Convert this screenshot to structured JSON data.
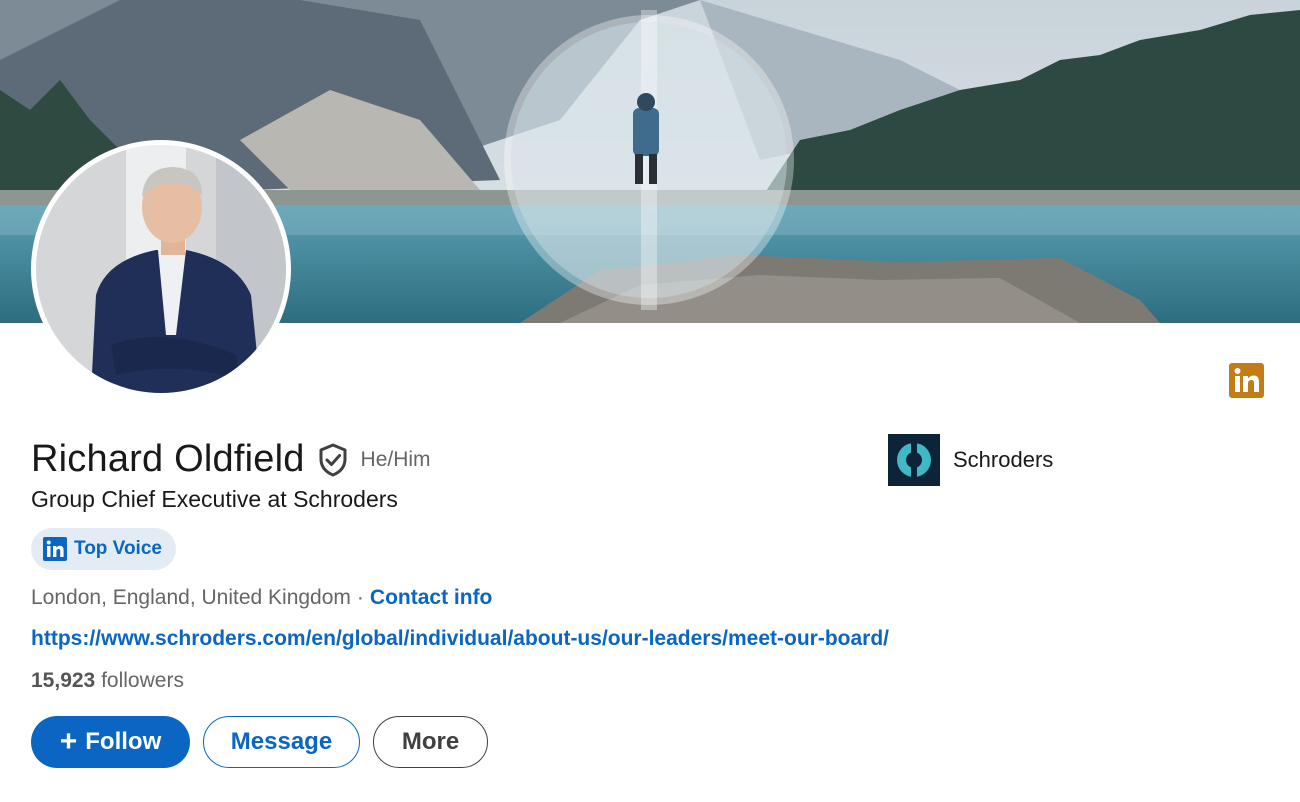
{
  "profile": {
    "name": "Richard Oldfield",
    "pronouns": "He/Him",
    "headline": "Group Chief Executive at Schroders",
    "badge_label": "Top Voice",
    "location": "London, England, United Kingdom",
    "separator": "·",
    "contact_label": "Contact info",
    "website": "https://www.schroders.com/en/global/individual/about-us/our-leaders/meet-our-board/",
    "followers_count": "15,923",
    "followers_label": "followers"
  },
  "company": {
    "name": "Schroders"
  },
  "actions": {
    "follow_icon": "+",
    "follow_label": "Follow",
    "message_label": "Message",
    "more_label": "More"
  },
  "icons": {
    "verified": "shield-check-icon",
    "linkedin": "linkedin-icon",
    "top_voice": "linkedin-icon"
  },
  "colors": {
    "accent": "#0a66c2",
    "linkedin_badge": "#c37d16",
    "top_voice_bg": "#e3ecf5",
    "company_logo_bg": "#0d2438"
  }
}
